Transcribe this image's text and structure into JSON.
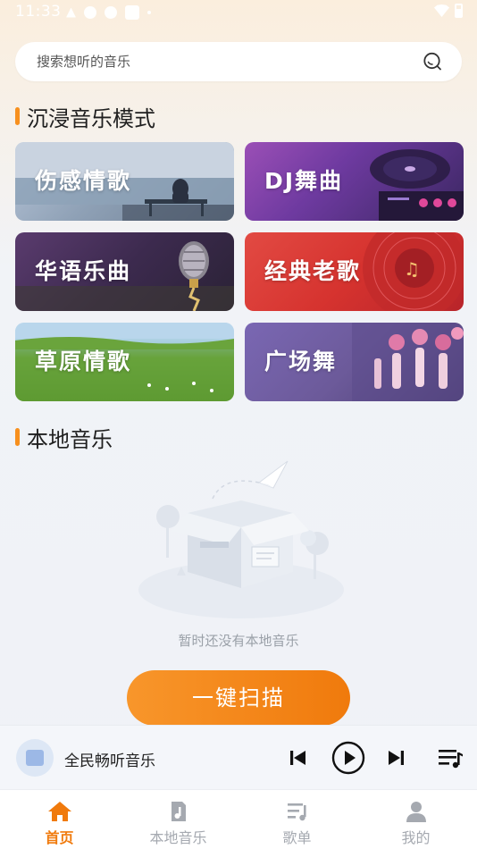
{
  "status_bar": {
    "time": "11:33"
  },
  "search": {
    "placeholder": "搜索想听的音乐"
  },
  "sections": {
    "mode_title": "沉浸音乐模式",
    "local_title": "本地音乐"
  },
  "modes": [
    {
      "label": "伤感情歌"
    },
    {
      "label": "DJ舞曲"
    },
    {
      "label": "华语乐曲"
    },
    {
      "label": "经典老歌"
    },
    {
      "label": "草原情歌"
    },
    {
      "label": "广场舞"
    }
  ],
  "empty_state": {
    "text": "暂时还没有本地音乐",
    "button_label": "一键扫描"
  },
  "player": {
    "title": "全民畅听音乐"
  },
  "tabbar": {
    "items": [
      {
        "label": "首页",
        "icon": "home-icon",
        "active": true
      },
      {
        "label": "本地音乐",
        "icon": "music-file-icon",
        "active": false
      },
      {
        "label": "歌单",
        "icon": "playlist-icon",
        "active": false
      },
      {
        "label": "我的",
        "icon": "user-icon",
        "active": false
      }
    ]
  },
  "colors": {
    "accent": "#f07a0c",
    "accent_light": "#f8962b",
    "muted": "#a5a9b0"
  }
}
